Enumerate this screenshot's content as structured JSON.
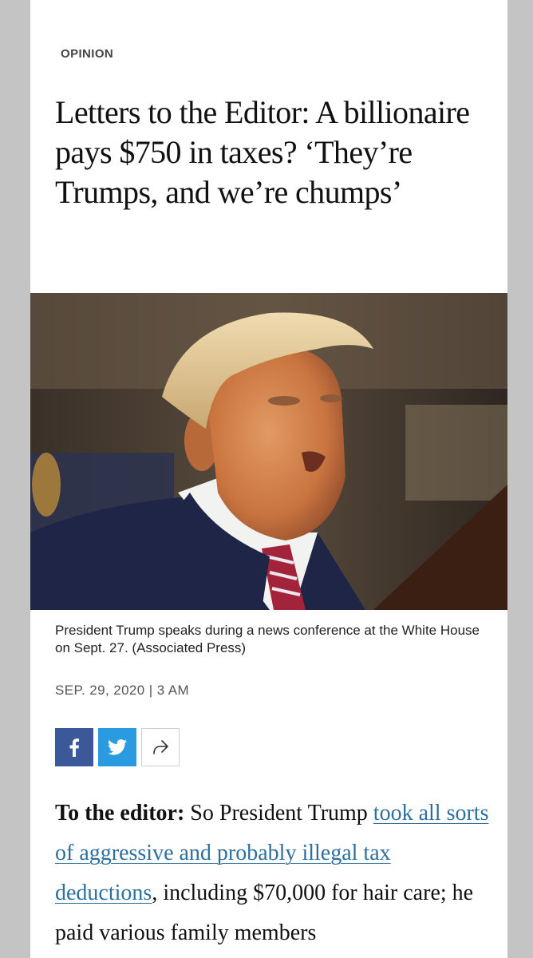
{
  "article": {
    "section": "OPINION",
    "headline": "Letters to the Editor: A billionaire pays $750 in taxes? ‘They’re Trumps, and we’re chumps’",
    "photo": {
      "caption": "President Trump speaks during a news conference at the White House on Sept. 27.  (Associated Press)"
    },
    "dateline": "SEP. 29, 2020 | 3 AM",
    "share": {
      "facebook_icon": "facebook-icon",
      "twitter_icon": "twitter-icon",
      "share_icon": "share-arrow-icon"
    },
    "body": {
      "lead": "To the editor:",
      "text_before_link": " So President Trump ",
      "link_text": "took all sorts of aggressive and probably illegal tax deductions",
      "text_after_link": ", including $70,000 for hair care; he paid various family members"
    }
  },
  "colors": {
    "background_gutter": "#c4c4c4",
    "facebook": "#3b5998",
    "twitter": "#2a9be0",
    "link": "#2d6f9f"
  }
}
